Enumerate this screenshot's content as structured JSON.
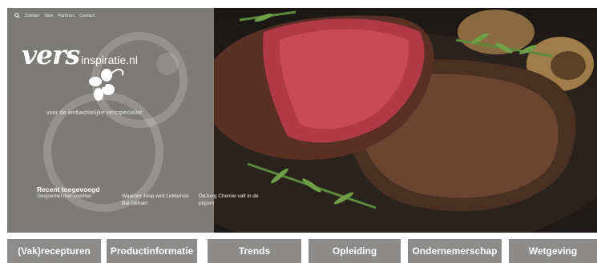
{
  "topnav": {
    "items": [
      "Zoeken",
      "Vers",
      "Partners",
      "Contact"
    ]
  },
  "logo": {
    "vers": "vers",
    "rest": "inspiratie.nl"
  },
  "tagline": "voor de ambachtelijke versspecialist",
  "recent": {
    "title": "Recent toegevoegd",
    "items": [
      "Gesjoemel met voedsel",
      "Waarom Joop wint Lekkerste Bal Gehakt",
      "DeJong Chemie valt in de prijzen"
    ]
  },
  "bottom_nav": [
    "(Vak)recepturen",
    "Productinformatie",
    "Trends",
    "Opleiding",
    "Ondernemerschap",
    "Wetgeving"
  ],
  "colors": {
    "panel": "#84827f",
    "tile": "#8d8c8a",
    "text": "#ffffff"
  }
}
